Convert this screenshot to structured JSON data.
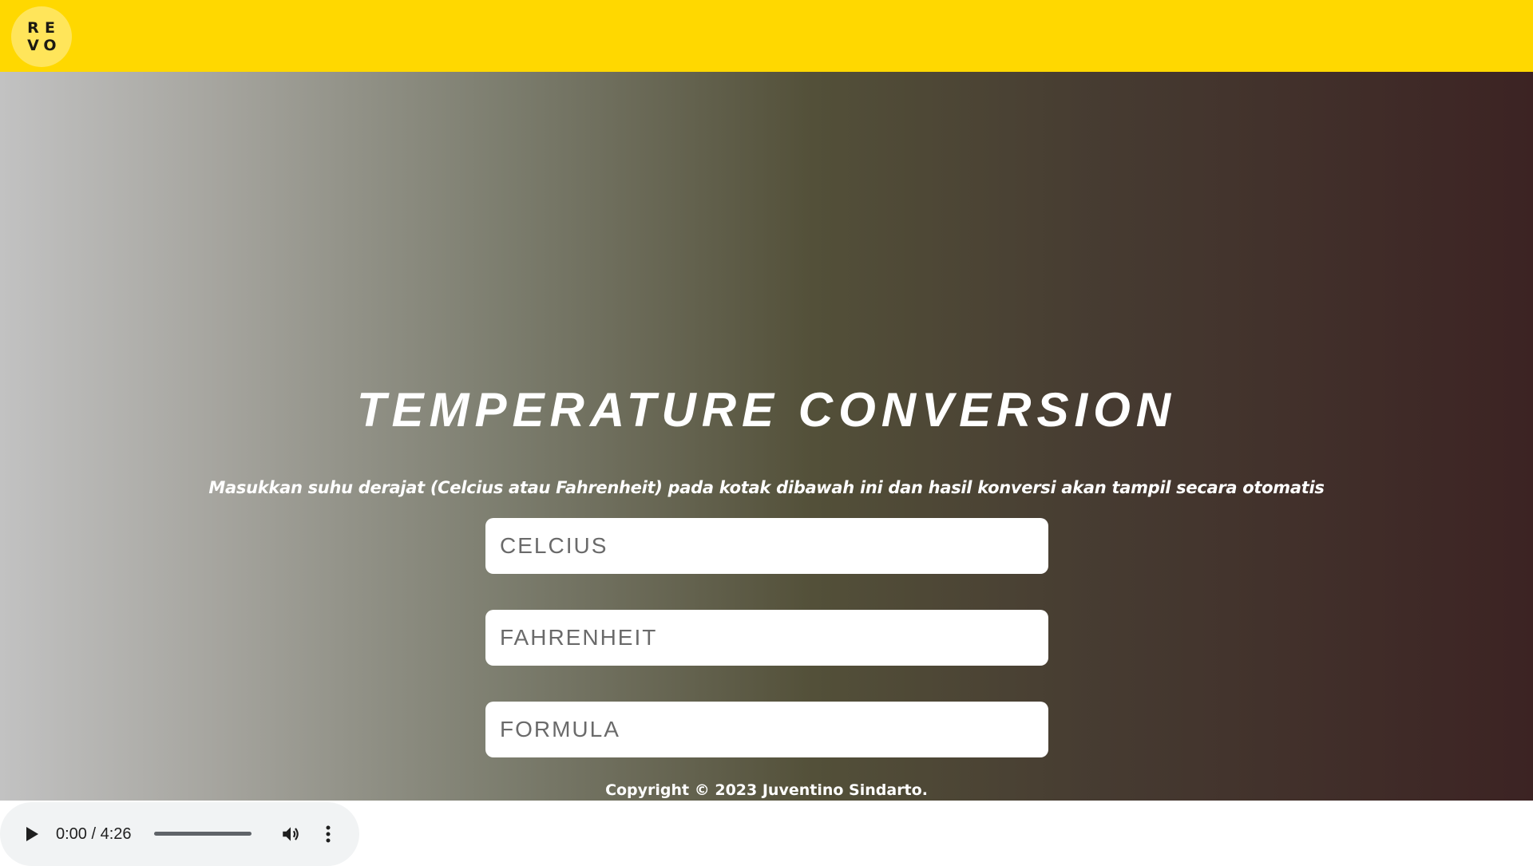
{
  "header": {
    "logo_letters": [
      "R",
      "E",
      "V",
      "O"
    ],
    "background_color": "#ffd800"
  },
  "hero": {
    "title": "TEMPERATURE CONVERSION",
    "subtitle": "Masukkan suhu derajat (Celcius atau Fahrenheit) pada kotak dibawah ini dan hasil konversi akan tampil secara otomatis",
    "gradient_colors": [
      "#c2c2c2",
      "#7c7d6e",
      "#535039",
      "#3c2323"
    ]
  },
  "form": {
    "celcius": {
      "placeholder": "CELCIUS",
      "value": ""
    },
    "fahrenheit": {
      "placeholder": "FAHRENHEIT",
      "value": ""
    },
    "formula": {
      "placeholder": "FORMULA",
      "value": ""
    }
  },
  "footer": {
    "copyright": "Copyright © 2023 Juventino Sindarto."
  },
  "audio_player": {
    "time_display": "0:00 / 4:26",
    "current_time": "0:00",
    "duration": "4:26",
    "progress": 0,
    "icons": [
      "play-icon",
      "volume-icon",
      "more-vertical-icon"
    ]
  }
}
